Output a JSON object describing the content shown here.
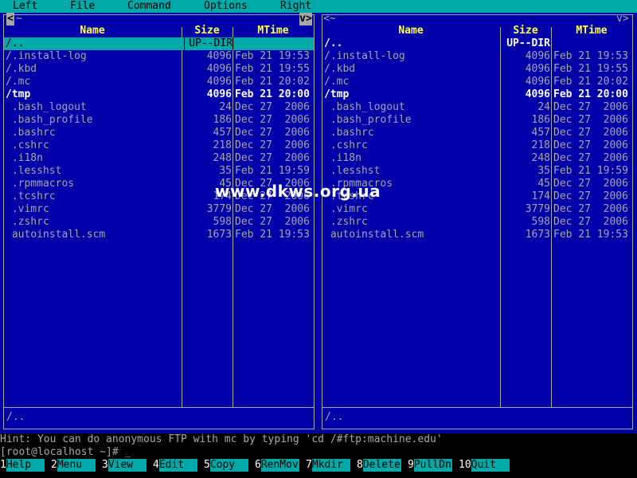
{
  "menu": [
    "Left",
    "File",
    "Command",
    "Options",
    "Right"
  ],
  "left_panel": {
    "corner_left": "<",
    "corner_right": "v>",
    "headers": {
      "name": "Name",
      "size": "Size",
      "mtime": "MTime"
    },
    "rows": [
      {
        "name": "/..",
        "size": "UP--DIR",
        "mtime": "",
        "kind": "selected"
      },
      {
        "name": "/.install-log",
        "size": "4096",
        "mtime": "Feb 21 19:53",
        "kind": "hidden"
      },
      {
        "name": "/.kbd",
        "size": "4096",
        "mtime": "Feb 21 19:55",
        "kind": "hidden"
      },
      {
        "name": "/.mc",
        "size": "4096",
        "mtime": "Feb 21 20:02",
        "kind": "hidden"
      },
      {
        "name": "/tmp",
        "size": "4096",
        "mtime": "Feb 21 20:00",
        "kind": "bright"
      },
      {
        "name": " .bash_logout",
        "size": "24",
        "mtime": "Dec 27  2006",
        "kind": "hidden"
      },
      {
        "name": " .bash_profile",
        "size": "186",
        "mtime": "Dec 27  2006",
        "kind": "hidden"
      },
      {
        "name": " .bashrc",
        "size": "457",
        "mtime": "Dec 27  2006",
        "kind": "hidden"
      },
      {
        "name": " .cshrc",
        "size": "218",
        "mtime": "Dec 27  2006",
        "kind": "hidden"
      },
      {
        "name": " .i18n",
        "size": "248",
        "mtime": "Dec 27  2006",
        "kind": "hidden"
      },
      {
        "name": " .lesshst",
        "size": "35",
        "mtime": "Feb 21 19:59",
        "kind": "hidden"
      },
      {
        "name": " .rpmmacros",
        "size": "45",
        "mtime": "Dec 27  2006",
        "kind": "hidden"
      },
      {
        "name": " .tcshrc",
        "size": "174",
        "mtime": "Dec 27  2006",
        "kind": "hidden"
      },
      {
        "name": " .vimrc",
        "size": "3779",
        "mtime": "Dec 27  2006",
        "kind": "hidden"
      },
      {
        "name": " .zshrc",
        "size": "598",
        "mtime": "Dec 27  2006",
        "kind": "hidden"
      },
      {
        "name": " autoinstall.scm",
        "size": "1673",
        "mtime": "Feb 21 19:53",
        "kind": "file"
      }
    ],
    "mini_status": "/.."
  },
  "right_panel": {
    "corner_left": "<~",
    "corner_right": "v>",
    "headers": {
      "name": "Name",
      "size": "Size",
      "mtime": "MTime"
    },
    "rows": [
      {
        "name": "/..",
        "size": "UP--DIR",
        "mtime": "",
        "kind": "bright"
      },
      {
        "name": "/.install-log",
        "size": "4096",
        "mtime": "Feb 21 19:53",
        "kind": "hidden"
      },
      {
        "name": "/.kbd",
        "size": "4096",
        "mtime": "Feb 21 19:55",
        "kind": "hidden"
      },
      {
        "name": "/.mc",
        "size": "4096",
        "mtime": "Feb 21 20:02",
        "kind": "hidden"
      },
      {
        "name": "/tmp",
        "size": "4096",
        "mtime": "Feb 21 20:00",
        "kind": "bright"
      },
      {
        "name": " .bash_logout",
        "size": "24",
        "mtime": "Dec 27  2006",
        "kind": "hidden"
      },
      {
        "name": " .bash_profile",
        "size": "186",
        "mtime": "Dec 27  2006",
        "kind": "hidden"
      },
      {
        "name": " .bashrc",
        "size": "457",
        "mtime": "Dec 27  2006",
        "kind": "hidden"
      },
      {
        "name": " .cshrc",
        "size": "218",
        "mtime": "Dec 27  2006",
        "kind": "hidden"
      },
      {
        "name": " .i18n",
        "size": "248",
        "mtime": "Dec 27  2006",
        "kind": "hidden"
      },
      {
        "name": " .lesshst",
        "size": "35",
        "mtime": "Feb 21 19:59",
        "kind": "hidden"
      },
      {
        "name": " .rpmmacros",
        "size": "45",
        "mtime": "Dec 27  2006",
        "kind": "hidden"
      },
      {
        "name": " .tcshrc",
        "size": "174",
        "mtime": "Dec 27  2006",
        "kind": "hidden"
      },
      {
        "name": " .vimrc",
        "size": "3779",
        "mtime": "Dec 27  2006",
        "kind": "hidden"
      },
      {
        "name": " .zshrc",
        "size": "598",
        "mtime": "Dec 27  2006",
        "kind": "hidden"
      },
      {
        "name": " autoinstall.scm",
        "size": "1673",
        "mtime": "Feb 21 19:53",
        "kind": "file"
      }
    ],
    "mini_status": "/.."
  },
  "watermark": "www.dkws.org.ua",
  "hint": "Hint: You can do anonymous FTP with mc by typing 'cd /#ftp:machine.edu'",
  "prompt": "[root@localhost ~]# _",
  "fkeys": [
    {
      "num": "1",
      "label": "Help"
    },
    {
      "num": "2",
      "label": "Menu"
    },
    {
      "num": "3",
      "label": "View"
    },
    {
      "num": "4",
      "label": "Edit"
    },
    {
      "num": "5",
      "label": "Copy"
    },
    {
      "num": "6",
      "label": "RenMov"
    },
    {
      "num": "7",
      "label": "Mkdir"
    },
    {
      "num": "8",
      "label": "Delete"
    },
    {
      "num": "9",
      "label": "PullDn"
    },
    {
      "num": "10",
      "label": "Quit"
    }
  ],
  "colors": {
    "panel_bg": "#0000a8",
    "menu_bg": "#00a8a8",
    "header_fg": "#ffff54",
    "line": "#a8a8a8"
  }
}
